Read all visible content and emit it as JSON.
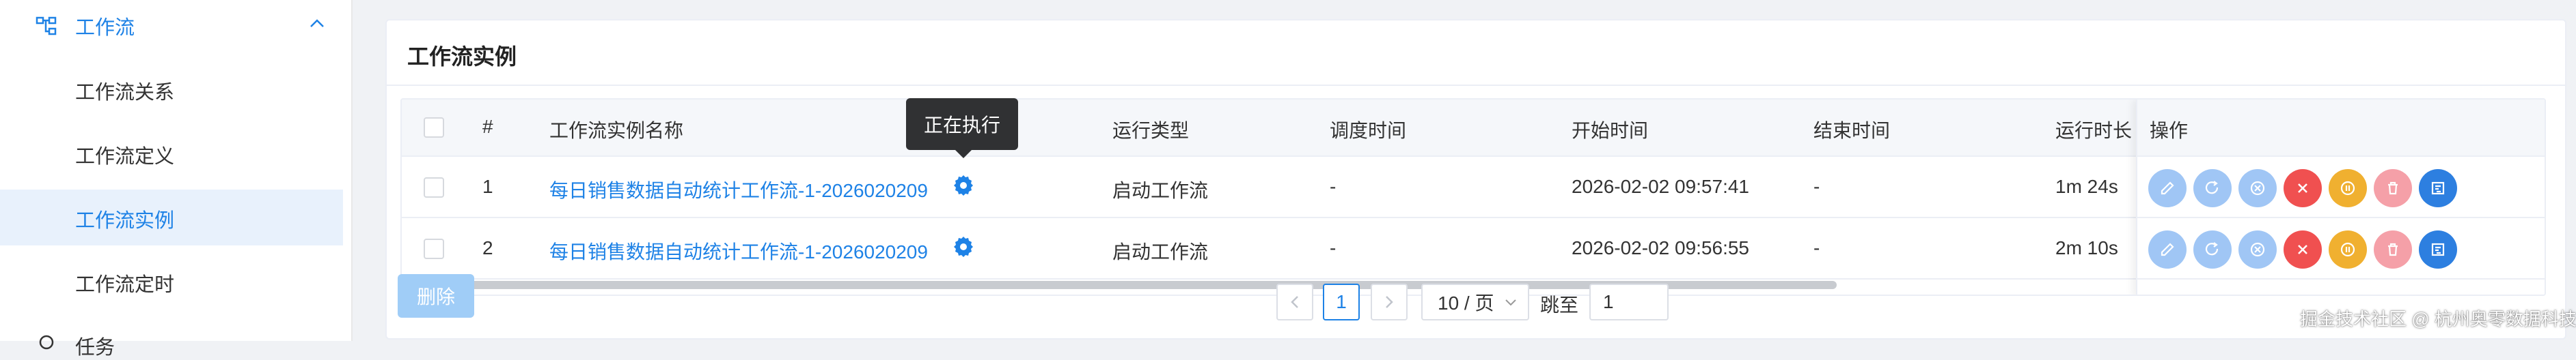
{
  "sidebar": {
    "group_label": "工作流",
    "items": [
      {
        "label": "工作流关系"
      },
      {
        "label": "工作流定义"
      },
      {
        "label": "工作流实例"
      },
      {
        "label": "工作流定时"
      }
    ],
    "next_group_label": "任务",
    "active_index": 2,
    "accent_color": "#1e82e6"
  },
  "card": {
    "title": "工作流实例"
  },
  "table": {
    "headers": {
      "index": "#",
      "name": "工作流实例名称",
      "run_type": "运行类型",
      "schedule_time": "调度时间",
      "start_time": "开始时间",
      "end_time": "结束时间",
      "duration": "运行时长",
      "ops": "操作"
    },
    "rows": [
      {
        "index": "1",
        "name": "每日销售数据自动统计工作流-1-2026020209",
        "run_type": "启动工作流",
        "schedule_time": "-",
        "start_time": "2026-02-02 09:57:41",
        "end_time": "-",
        "duration": "1m 24s",
        "status_icon": "gear-icon"
      },
      {
        "index": "2",
        "name": "每日销售数据自动统计工作流-1-2026020209",
        "run_type": "启动工作流",
        "schedule_time": "-",
        "start_time": "2026-02-02 09:56:55",
        "end_time": "-",
        "duration": "2m 10s",
        "status_icon": "gear-icon"
      }
    ],
    "op_buttons": [
      {
        "icon": "edit-icon",
        "color": "#a0c6f5"
      },
      {
        "icon": "rerun-icon",
        "color": "#a0c6f5"
      },
      {
        "icon": "stop-icon",
        "color": "#a0c6f5"
      },
      {
        "icon": "close-icon",
        "color": "#f05050"
      },
      {
        "icon": "pause-icon",
        "color": "#f0b030"
      },
      {
        "icon": "delete-icon",
        "color": "#f5a0a8"
      },
      {
        "icon": "gantt-icon",
        "color": "#2d7fe0"
      }
    ]
  },
  "tooltip": {
    "text": "正在执行"
  },
  "footer": {
    "delete_label": "删除",
    "current_page": "1",
    "page_size": "10 / 页",
    "jump_label": "跳至",
    "jump_value": "1"
  },
  "watermark": "掘金技术社区 @ 杭州奥零数据科技"
}
